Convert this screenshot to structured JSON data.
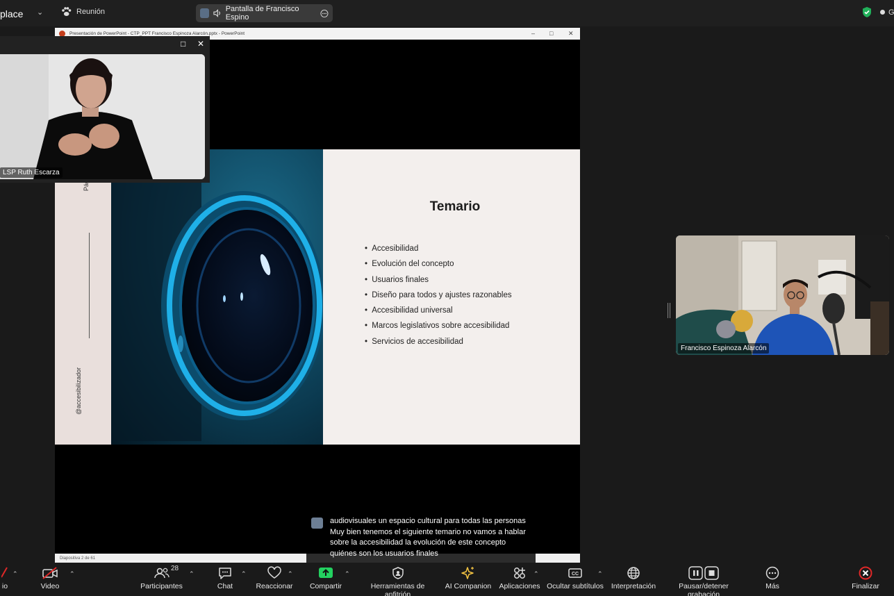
{
  "topbar": {
    "app_name": "place",
    "meeting_label": "Reunión",
    "share_label": "Pantalla de Francisco Espino",
    "right_initial": "G"
  },
  "ppt": {
    "window_title": "Presentación de PowerPoint  -  CTP_PPT Francisco Espinoza Alarcón.pptx - PowerPoint",
    "status_text": "Diapositiva 2 de 61",
    "slide": {
      "side_label": "Página",
      "handle": "@accesibilizador",
      "title": "Temario",
      "topics": [
        "Accesibilidad",
        "Evolución del concepto",
        "Usuarios finales",
        "Diseño para todos y ajustes razonables",
        "Accesibilidad universal",
        "Marcos legislativos sobre accesibilidad",
        "Servicios de accesibilidad"
      ]
    }
  },
  "caption": {
    "text": "audiovisuales un espacio cultural para todas las personas Muy bien tenemos el siguiente temario no vamos a hablar sobre la accesibilidad la evolución de este concepto quiénes son los usuarios finales"
  },
  "videos": {
    "interpreter_name": "LSP Ruth Escarza",
    "speaker_name": "Francisco Espinoza Alarcón"
  },
  "toolbar": {
    "audio_label": "io",
    "video_label": "Video",
    "participants_label": "Participantes",
    "participants_count": "28",
    "chat_label": "Chat",
    "react_label": "Reaccionar",
    "share_label": "Compartir",
    "host_tools_label": "Herramientas de anfitrión",
    "ai_label": "AI Companion",
    "apps_label": "Aplicaciones",
    "captions_label": "Ocultar subtítulos",
    "interpretation_label": "Interpretación",
    "record_label": "Pausar/detener grabación",
    "more_label": "Más",
    "end_label": "Finalizar"
  },
  "colors": {
    "share_green": "#23d160",
    "end_red": "#e02828",
    "shield_green": "#21b15a",
    "ai_gold": "#f5c542"
  }
}
